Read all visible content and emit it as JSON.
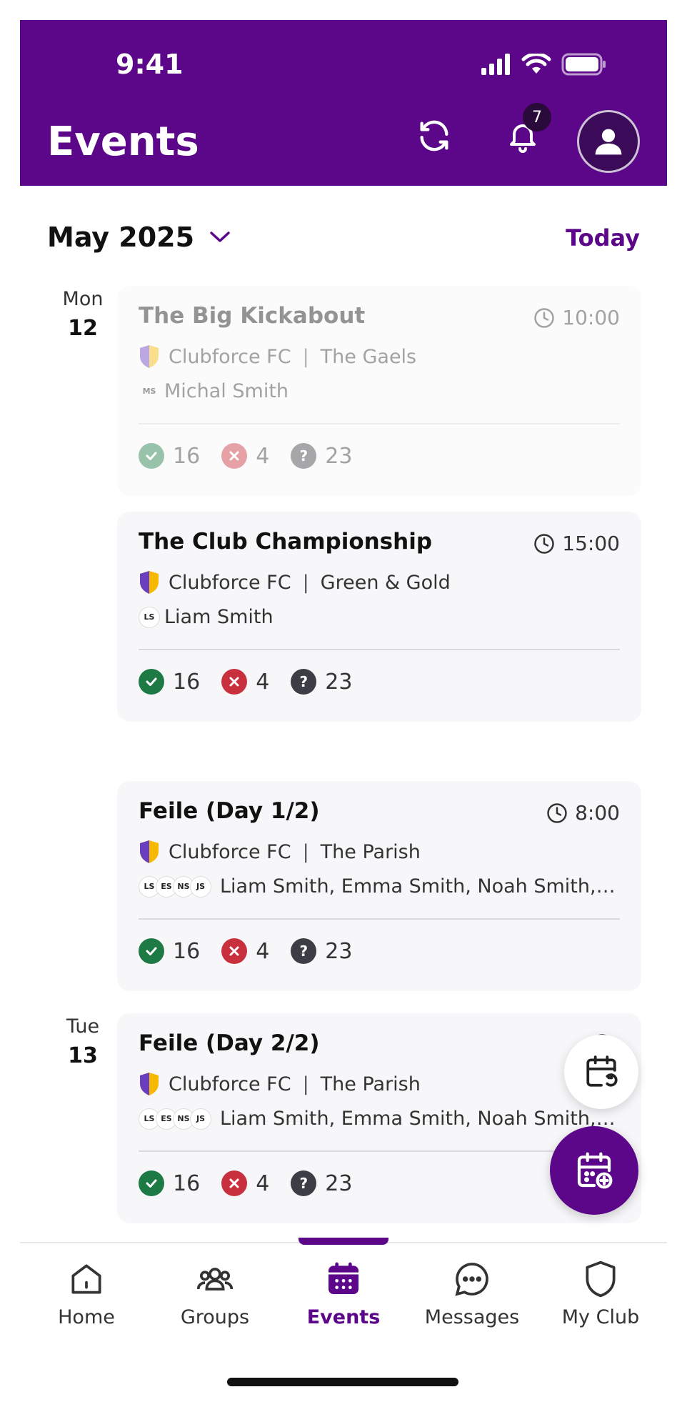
{
  "status_bar": {
    "time": "9:41"
  },
  "header": {
    "title": "Events",
    "notification_count": "7"
  },
  "month_bar": {
    "month": "May 2025",
    "today_label": "Today"
  },
  "days": [
    {
      "dow": "Mon",
      "day": "12"
    },
    {
      "dow": "Tue",
      "day": "13"
    }
  ],
  "events": [
    {
      "title": "The Big Kickabout",
      "time": "10:00",
      "club": "Clubforce FC",
      "team": "The Gaels",
      "people_initials": [
        "MS"
      ],
      "people": "Michal Smith",
      "going": "16",
      "not_going": "4",
      "unknown": "23",
      "faded": true
    },
    {
      "title": "The Club Championship",
      "time": "15:00",
      "club": "Clubforce FC",
      "team": "Green & Gold",
      "people_initials": [
        "LS"
      ],
      "people": "Liam Smith",
      "going": "16",
      "not_going": "4",
      "unknown": "23"
    },
    {
      "title": "Feile (Day 1/2)",
      "time": "8:00",
      "club": "Clubforce FC",
      "team": "The Parish",
      "people_initials": [
        "LS",
        "ES",
        "NS",
        "JS"
      ],
      "people": "Liam Smith, Emma Smith, Noah Smith, Jor...",
      "going": "16",
      "not_going": "4",
      "unknown": "23"
    },
    {
      "title": "Feile (Day 2/2)",
      "time": "",
      "club": "Clubforce FC",
      "team": "The Parish",
      "people_initials": [
        "LS",
        "ES",
        "NS",
        "JS"
      ],
      "people": "Liam Smith, Emma Smith, Noah Smith, Jor...",
      "going": "16",
      "not_going": "4",
      "unknown": "23"
    }
  ],
  "tabs": [
    {
      "label": "Home",
      "icon": "home-icon"
    },
    {
      "label": "Groups",
      "icon": "groups-icon"
    },
    {
      "label": "Events",
      "icon": "calendar-icon",
      "active": true
    },
    {
      "label": "Messages",
      "icon": "chat-icon"
    },
    {
      "label": "My Club",
      "icon": "shield-icon"
    }
  ],
  "colors": {
    "brand": "#5c0789",
    "going": "#1e7a44",
    "not_going": "#c8303e",
    "unknown": "#3d3d45"
  }
}
